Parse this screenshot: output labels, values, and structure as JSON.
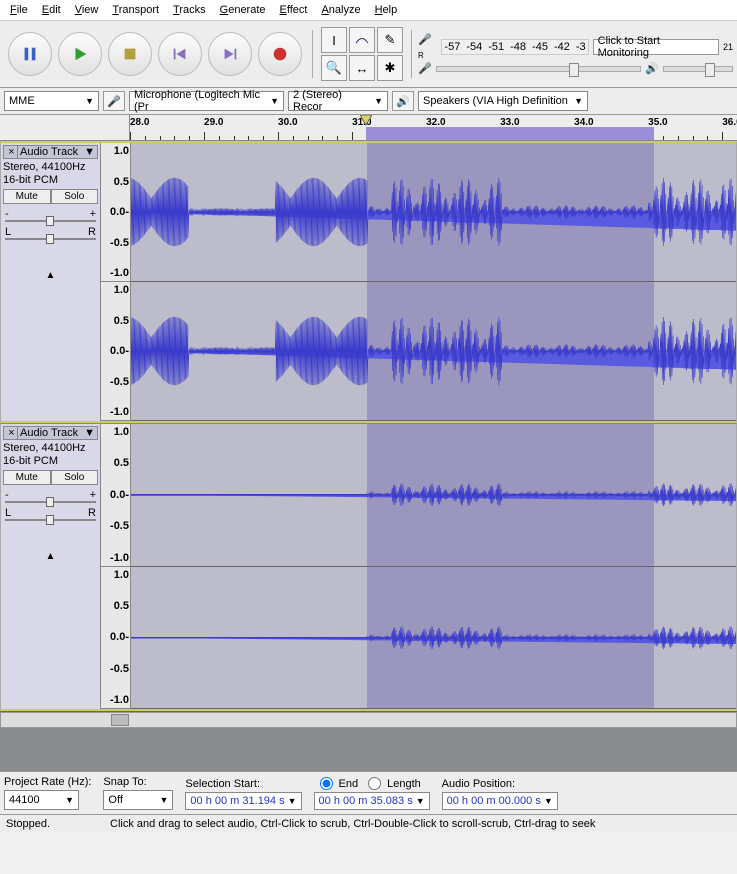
{
  "menu": [
    "File",
    "Edit",
    "View",
    "Transport",
    "Tracks",
    "Generate",
    "Effect",
    "Analyze",
    "Help"
  ],
  "meter_numbers": [
    "-57",
    "-54",
    "-51",
    "-48",
    "-45",
    "-42",
    "-3"
  ],
  "monitor_text": "Click to Start Monitoring",
  "host": "MME",
  "rec_device": "Microphone (Logitech Mic (Pr",
  "rec_channels": "2 (Stereo) Recor",
  "play_device": "Speakers (VIA High Definition",
  "ruler": {
    "start": 28.0,
    "end": 36.2,
    "ticks": [
      28.0,
      29.0,
      30.0,
      31.0,
      32.0,
      33.0,
      34.0,
      35.0,
      36.0
    ],
    "sel_start": 31.194,
    "sel_end": 35.083
  },
  "track1": {
    "name": "Audio Track",
    "info1": "Stereo, 44100Hz",
    "info2": "16-bit PCM",
    "mute": "Mute",
    "solo": "Solo"
  },
  "track2": {
    "name": "Audio Track",
    "info1": "Stereo, 44100Hz",
    "info2": "16-bit PCM",
    "mute": "Mute",
    "solo": "Solo"
  },
  "scale_labels": [
    "1.0",
    "0.5",
    "0.0-",
    "-0.5",
    "-1.0"
  ],
  "project_rate_label": "Project Rate (Hz):",
  "project_rate": "44100",
  "snap_label": "Snap To:",
  "snap_value": "Off",
  "sel_start_label": "Selection Start:",
  "sel_start_value": "00 h 00 m 31.194 s",
  "end_label": "End",
  "length_label": "Length",
  "sel_end_value": "00 h 00 m 35.083 s",
  "audio_pos_label": "Audio Position:",
  "audio_pos_value": "00 h 00 m 00.000 s",
  "status_left": "Stopped.",
  "status_right": "Click and drag to select audio, Ctrl-Click to scrub, Ctrl-Double-Click to scroll-scrub, Ctrl-drag to seek"
}
